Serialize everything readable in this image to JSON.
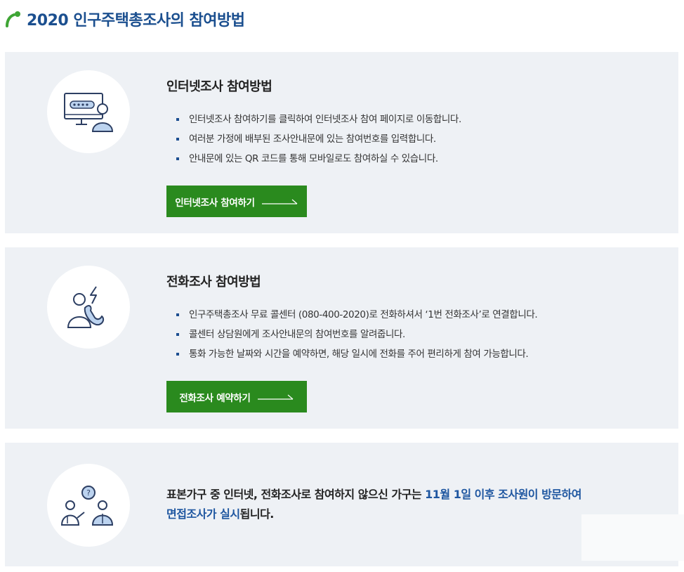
{
  "page": {
    "title": "2020 인구주택총조사의 참여방법"
  },
  "internet": {
    "icon": "computer-user-icon",
    "title": "인터넷조사 참여방법",
    "bullets": [
      "인터넷조사 참여하기를 클릭하여 인터넷조사 참여 페이지로 이동합니다.",
      "여러분 가정에 배부된 조사안내문에 있는 참여번호를 입력합니다.",
      "안내문에 있는 QR 코드를 통해 모바일로도 참여하실 수 있습니다."
    ],
    "button_label": "인터넷조사 참여하기"
  },
  "phone": {
    "icon": "phone-call-icon",
    "title": "전화조사 참여방법",
    "bullets": [
      "인구주택총조사 무료 콜센터 (080-400-2020)로 전화하셔서 ‘1번 전화조사’로 연결합니다.",
      "콜센터 상담원에게 조사안내문의 참여번호를 알려줍니다.",
      "통화 가능한 날짜와 시간을 예약하면, 해당 일시에 전화를 주어 편리하게 참여 가능합니다."
    ],
    "button_label": "전화조사 예약하기"
  },
  "visit": {
    "icon": "interview-icon",
    "text_part1": "표본가구 중 인터넷, 전화조사로 참여하지 않으신 가구는 ",
    "text_highlight1": "11월 1일 이후 조사원이 방문하여",
    "text_highlight2": "면접조사가 실시",
    "text_part2": "됩니다."
  },
  "colors": {
    "title": "#1b4f8f",
    "accent_green": "#2a8a1e",
    "panel_bg": "#eef1f5",
    "highlight_blue": "#1e56a0"
  }
}
